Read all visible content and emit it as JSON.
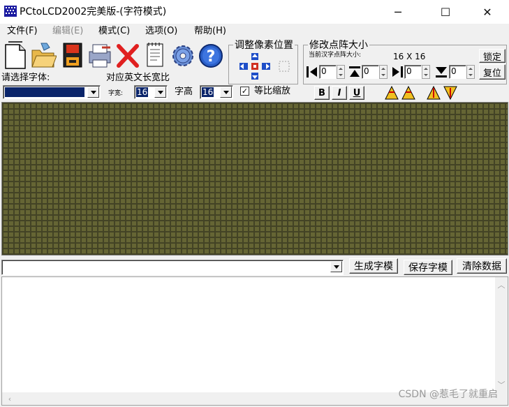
{
  "window": {
    "title": "PCtoLCD2002完美版-(字符模式)",
    "minimize": "─",
    "maximize": "☐",
    "close": "✕"
  },
  "menu": [
    {
      "label": "文件(F)",
      "disabled": false
    },
    {
      "label": "编辑(E)",
      "disabled": true
    },
    {
      "label": "模式(C)",
      "disabled": false
    },
    {
      "label": "选项(O)",
      "disabled": false
    },
    {
      "label": "帮助(H)",
      "disabled": false
    }
  ],
  "toolbar": {
    "icons": [
      "new-file-icon",
      "open-folder-icon",
      "save-disk-icon",
      "print-icon",
      "delete-x-icon",
      "notepad-icon",
      "settings-gear-icon",
      "help-icon"
    ]
  },
  "pixel_adjust": {
    "title": "调整像素位置"
  },
  "matrix_size": {
    "title": "修改点阵大小",
    "current_label": "当前汉字点阵大小:",
    "current_value": "16  X  16",
    "lock_button": "锁定",
    "reset_button": "复位",
    "spinners": [
      "0",
      "0",
      "0",
      "0"
    ]
  },
  "font": {
    "select_label": "请选择字体:",
    "ratio_label": "对应英文长宽比",
    "width_label": "字宽:",
    "width_value": "16",
    "height_label": "字高",
    "height_value": "16",
    "proportional_label": "等比缩放",
    "proportional_checked": "✓",
    "bold": "B",
    "italic": "I",
    "underline": "U"
  },
  "actions": {
    "generate": "生成字模",
    "save": "保存字模",
    "clear": "清除数据"
  },
  "output": {
    "watermark": "CSDN @惹毛了就重启"
  },
  "colors": {
    "matrix_bg": "#3c3c22",
    "matrix_grid": "#111111",
    "selection": "#0a246a"
  }
}
